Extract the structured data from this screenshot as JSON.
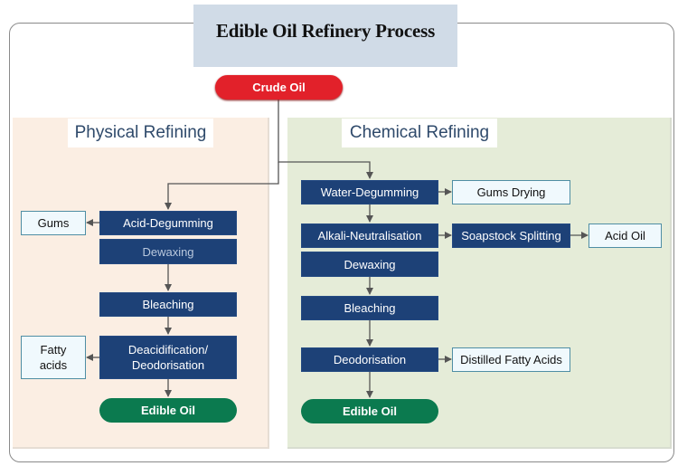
{
  "title": "Edible Oil Refinery Process",
  "start": "Crude Oil",
  "physical": {
    "title": "Physical Refining",
    "steps": [
      "Acid-Degumming",
      "Dewaxing",
      "Bleaching",
      "Deacidification/\nDeodorisation"
    ],
    "byproducts": [
      "Gums",
      "Fatty\nacids"
    ],
    "end": "Edible Oil"
  },
  "chemical": {
    "title": "Chemical Refining",
    "steps": [
      "Water-Degumming",
      "Alkali-Neutralisation",
      "Dewaxing",
      "Bleaching",
      "Deodorisation"
    ],
    "byproducts": [
      "Gums Drying",
      "Soapstock Splitting",
      "Acid Oil",
      "Distilled Fatty Acids"
    ],
    "end": "Edible Oil"
  },
  "colors": {
    "process_step": "#1d4177",
    "start_node": "#e2212a",
    "end_node": "#0b7a4f",
    "physical_panel": "#fbeee3",
    "chemical_panel": "#e5ecd8",
    "title_box": "#d0dbe7"
  }
}
